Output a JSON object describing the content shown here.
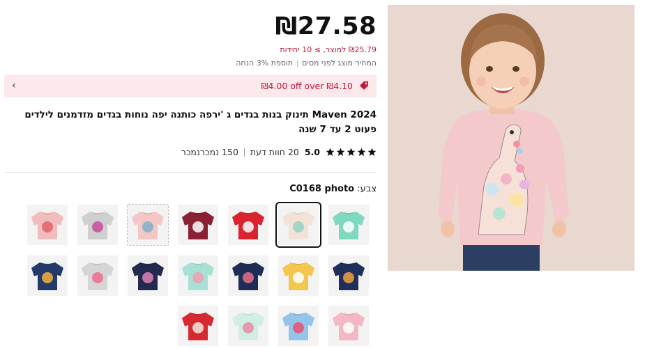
{
  "product": {
    "price": "₪27.58",
    "unit_price": "₪25.79 למוצר, ≥ 10 יחידות",
    "tax_note_a": "המחיר מוצג לפני מסים",
    "tax_note_b": "תוספת 3% הנחה",
    "promo_text": "₪4.00 off over ₪4.10",
    "title": "Maven 2024 תינוק בנות בגדים ג 'ירפה כותנה יפה נוחות בגדים מזדמנים לילדים פעוט 2 עד 7 שנה",
    "rating_score": "5.0",
    "reviews": "20 חוות דעת",
    "sold": "150 נמכרנמכר",
    "color_label": "צבע:",
    "color_value": "C0168 photo"
  },
  "swatches": [
    {
      "name": "mint-giraffe",
      "bg": "#7fd8c0",
      "accent": "#ffffff"
    },
    {
      "name": "beige-giraffe",
      "bg": "#f3e2d6",
      "accent": "#8fd3c6"
    },
    {
      "name": "red-unicorn",
      "bg": "#d9232e",
      "accent": "#ffffff"
    },
    {
      "name": "burgundy-llama",
      "bg": "#8b1f33",
      "accent": "#ffffff"
    },
    {
      "name": "pink-dino",
      "bg": "#f4c6c6",
      "accent": "#7fb0c9"
    },
    {
      "name": "grey-bag",
      "bg": "#cfcfcf",
      "accent": "#c84b9c"
    },
    {
      "name": "pink-print",
      "bg": "#f0bcbc",
      "accent": "#e0636b"
    },
    {
      "name": "navy-butterfly",
      "bg": "#1f2f5c",
      "accent": "#f2a13c"
    },
    {
      "name": "yellow-unicorn",
      "bg": "#f3c64d",
      "accent": "#ffffff"
    },
    {
      "name": "navy-butterflies",
      "bg": "#1e2d55",
      "accent": "#e66f8a"
    },
    {
      "name": "mint-ballerina",
      "bg": "#a7e1d6",
      "accent": "#f19db0"
    },
    {
      "name": "navy-dino",
      "bg": "#222a4e",
      "accent": "#e081b6"
    },
    {
      "name": "grey-rainbow-unicorn",
      "bg": "#d5d5d8",
      "accent": "#ef6c8c"
    },
    {
      "name": "navy-dinos",
      "bg": "#243a6a",
      "accent": "#f4b33c"
    },
    {
      "name": "pink-heart",
      "bg": "#f4b8c4",
      "accent": "#ffffff"
    },
    {
      "name": "blue-flowers",
      "bg": "#95c4ea",
      "accent": "#e94f6c"
    },
    {
      "name": "mint-flowers",
      "bg": "#cfeee4",
      "accent": "#e98aa2"
    },
    {
      "name": "red-cat",
      "bg": "#d62a33",
      "accent": "#f4e9dc"
    }
  ],
  "colors": {
    "accent": "#c0183a",
    "promo_bg": "#fde8ec"
  },
  "icons": {
    "promo": "tag-icon",
    "chevron": "chevron-left-icon",
    "rating": "star-icon"
  }
}
